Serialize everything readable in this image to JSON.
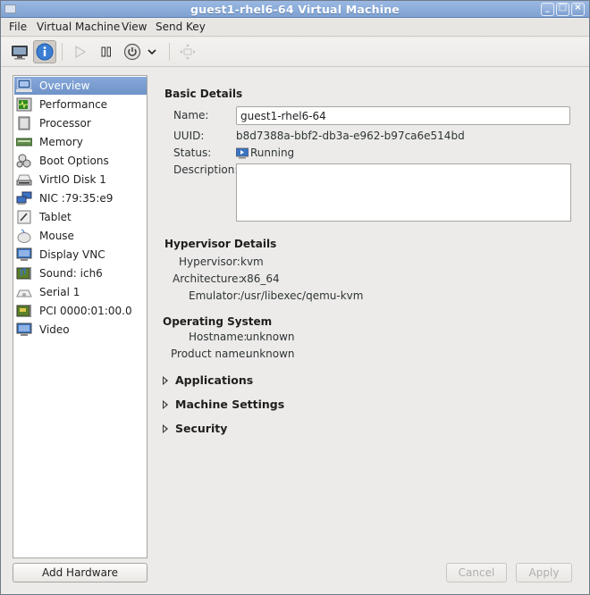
{
  "window": {
    "title": "guest1-rhel6-64 Virtual Machine",
    "controls": {
      "minimize": "_",
      "maximize": "□",
      "close": "×"
    }
  },
  "menubar": {
    "items": [
      "File",
      "Virtual Machine",
      "View",
      "Send Key"
    ]
  },
  "toolbar": {
    "buttons": [
      {
        "name": "console",
        "icon": "monitor-icon",
        "active": false,
        "enabled": true
      },
      {
        "name": "details",
        "icon": "info-icon",
        "active": true,
        "enabled": true
      },
      {
        "name": "run",
        "icon": "play-icon",
        "active": false,
        "enabled": false
      },
      {
        "name": "pause",
        "icon": "pause-icon",
        "active": false,
        "enabled": true
      },
      {
        "name": "shutdown",
        "icon": "power-icon",
        "active": false,
        "enabled": true
      },
      {
        "name": "shutdown-menu",
        "icon": "chevron-down-icon",
        "active": false,
        "enabled": true
      },
      {
        "name": "fullscreen",
        "icon": "move-icon",
        "active": false,
        "enabled": false
      }
    ]
  },
  "sidebar": {
    "items": [
      {
        "label": "Overview",
        "icon": "monitor-icon",
        "selected": true
      },
      {
        "label": "Performance",
        "icon": "performance-icon",
        "selected": false
      },
      {
        "label": "Processor",
        "icon": "cpu-icon",
        "selected": false
      },
      {
        "label": "Memory",
        "icon": "memory-icon",
        "selected": false
      },
      {
        "label": "Boot Options",
        "icon": "gears-icon",
        "selected": false
      },
      {
        "label": "VirtIO Disk 1",
        "icon": "disk-icon",
        "selected": false
      },
      {
        "label": "NIC :79:35:e9",
        "icon": "network-icon",
        "selected": false
      },
      {
        "label": "Tablet",
        "icon": "tablet-icon",
        "selected": false
      },
      {
        "label": "Mouse",
        "icon": "mouse-icon",
        "selected": false
      },
      {
        "label": "Display VNC",
        "icon": "display-icon",
        "selected": false
      },
      {
        "label": "Sound: ich6",
        "icon": "sound-card-icon",
        "selected": false
      },
      {
        "label": "Serial 1",
        "icon": "serial-icon",
        "selected": false
      },
      {
        "label": "PCI 0000:01:00.0",
        "icon": "pci-card-icon",
        "selected": false
      },
      {
        "label": "Video",
        "icon": "video-icon",
        "selected": false
      }
    ],
    "add_hardware_label": "Add Hardware"
  },
  "basic_details": {
    "title": "Basic Details",
    "name_label": "Name:",
    "name_value": "guest1-rhel6-64",
    "uuid_label": "UUID:",
    "uuid_value": "b8d7388a-bbf2-db3a-e962-b97ca6e514bd",
    "status_label": "Status:",
    "status_value": "Running",
    "description_label": "Description:",
    "description_value": ""
  },
  "hypervisor_details": {
    "title": "Hypervisor Details",
    "hypervisor_label": "Hypervisor:",
    "hypervisor_value": "kvm",
    "architecture_label": "Architecture:",
    "architecture_value": "x86_64",
    "emulator_label": "Emulator:",
    "emulator_value": "/usr/libexec/qemu-kvm"
  },
  "operating_system": {
    "title": "Operating System",
    "hostname_label": "Hostname:",
    "hostname_value": "unknown",
    "product_name_label": "Product name:",
    "product_name_value": "unknown"
  },
  "expanders": [
    {
      "label": "Applications",
      "expanded": false
    },
    {
      "label": "Machine Settings",
      "expanded": false
    },
    {
      "label": "Security",
      "expanded": false
    }
  ],
  "footer": {
    "cancel_label": "Cancel",
    "apply_label": "Apply"
  }
}
